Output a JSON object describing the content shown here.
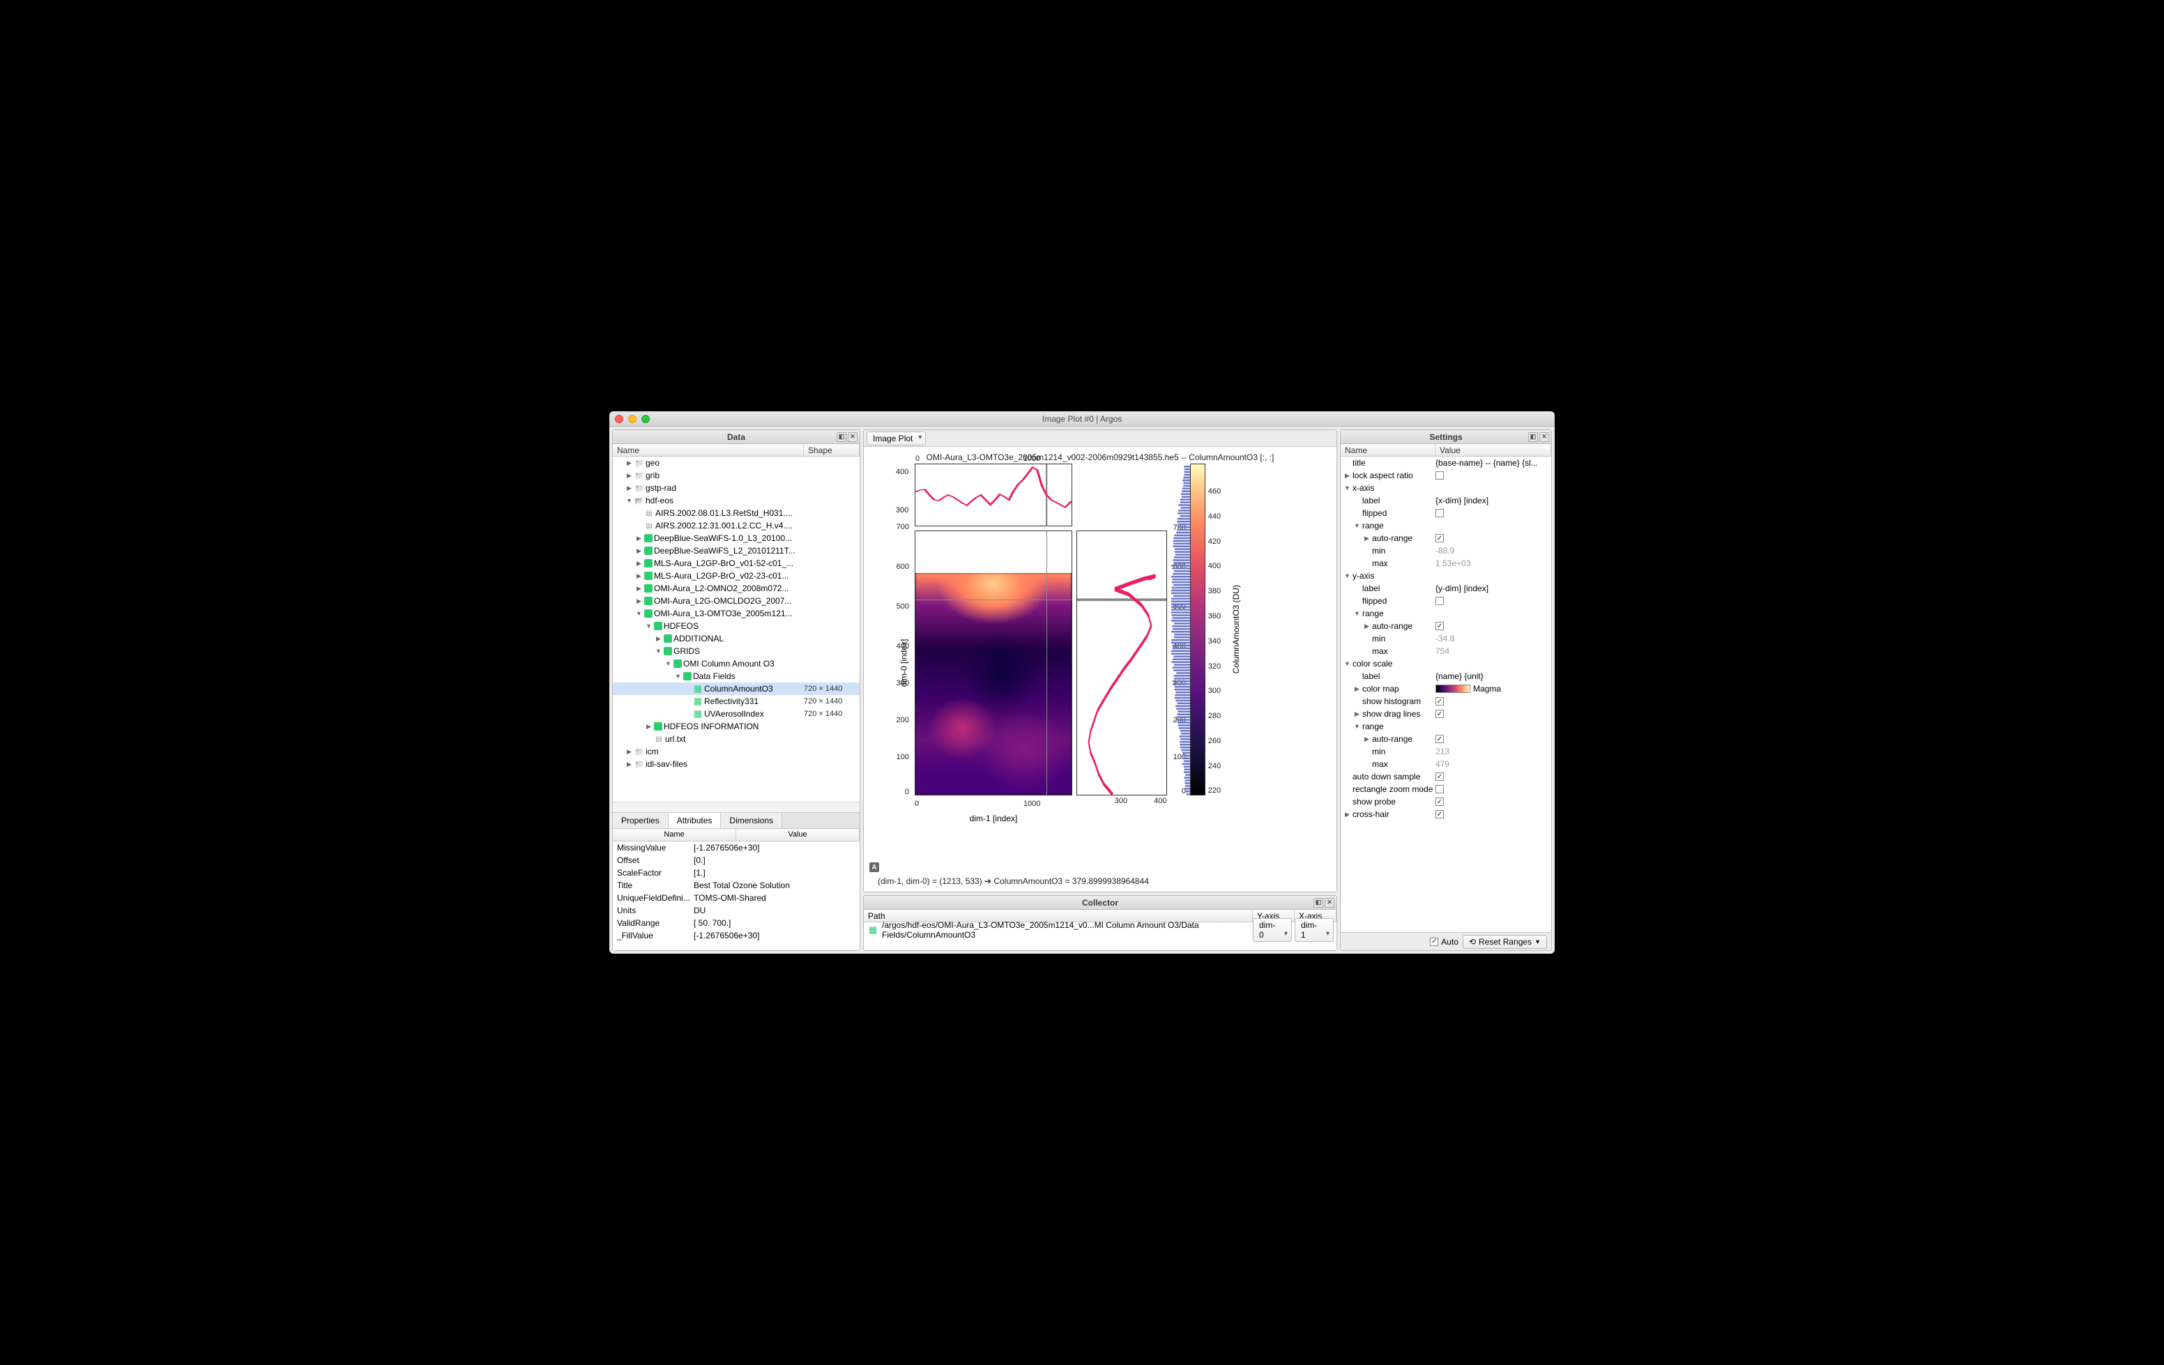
{
  "window": {
    "title": "Image Plot #0 | Argos"
  },
  "data_panel": {
    "title": "Data",
    "columns": {
      "name": "Name",
      "shape": "Shape"
    },
    "tree": [
      {
        "depth": 1,
        "twist": "closed",
        "icon": "folder",
        "label": "geo"
      },
      {
        "depth": 1,
        "twist": "closed",
        "icon": "folder",
        "label": "grib"
      },
      {
        "depth": 1,
        "twist": "closed",
        "icon": "folder",
        "label": "gstp-rad"
      },
      {
        "depth": 1,
        "twist": "open",
        "icon": "ofolder",
        "label": "hdf-eos"
      },
      {
        "depth": 2,
        "twist": "none",
        "icon": "file",
        "label": "AIRS.2002.08.01.L3.RetStd_H031...."
      },
      {
        "depth": 2,
        "twist": "none",
        "icon": "file",
        "label": "AIRS.2002.12.31.001.L2.CC_H.v4...."
      },
      {
        "depth": 2,
        "twist": "closed",
        "icon": "green",
        "label": "DeepBlue-SeaWiFS-1.0_L3_20100..."
      },
      {
        "depth": 2,
        "twist": "closed",
        "icon": "green",
        "label": "DeepBlue-SeaWiFS_L2_20101211T..."
      },
      {
        "depth": 2,
        "twist": "closed",
        "icon": "green",
        "label": "MLS-Aura_L2GP-BrO_v01-52-c01_..."
      },
      {
        "depth": 2,
        "twist": "closed",
        "icon": "green",
        "label": "MLS-Aura_L2GP-BrO_v02-23-c01..."
      },
      {
        "depth": 2,
        "twist": "closed",
        "icon": "green",
        "label": "OMI-Aura_L2-OMNO2_2008m072..."
      },
      {
        "depth": 2,
        "twist": "closed",
        "icon": "green",
        "label": "OMI-Aura_L2G-OMCLDO2G_2007..."
      },
      {
        "depth": 2,
        "twist": "open",
        "icon": "green",
        "label": "OMI-Aura_L3-OMTO3e_2005m121..."
      },
      {
        "depth": 3,
        "twist": "open",
        "icon": "green",
        "label": "HDFEOS"
      },
      {
        "depth": 4,
        "twist": "closed",
        "icon": "green",
        "label": "ADDITIONAL"
      },
      {
        "depth": 4,
        "twist": "open",
        "icon": "green",
        "label": "GRIDS"
      },
      {
        "depth": 5,
        "twist": "open",
        "icon": "green",
        "label": "OMI Column Amount O3"
      },
      {
        "depth": 6,
        "twist": "open",
        "icon": "green",
        "label": "Data Fields"
      },
      {
        "depth": 7,
        "twist": "none",
        "icon": "greeng",
        "label": "ColumnAmountO3",
        "shape": "720 × 1440",
        "selected": true
      },
      {
        "depth": 7,
        "twist": "none",
        "icon": "greeng",
        "label": "Reflectivity331",
        "shape": "720 × 1440"
      },
      {
        "depth": 7,
        "twist": "none",
        "icon": "greeng",
        "label": "UVAerosolIndex",
        "shape": "720 × 1440"
      },
      {
        "depth": 3,
        "twist": "closed",
        "icon": "green",
        "label": "HDFEOS INFORMATION"
      },
      {
        "depth": 3,
        "twist": "none",
        "icon": "file",
        "label": "url.txt"
      },
      {
        "depth": 1,
        "twist": "closed",
        "icon": "folder",
        "label": "icm"
      },
      {
        "depth": 1,
        "twist": "closed",
        "icon": "folder",
        "label": "idl-sav-files"
      }
    ],
    "tabs": {
      "t0": "Properties",
      "t1": "Attributes",
      "t2": "Dimensions",
      "active": 1
    },
    "attr_head": {
      "name": "Name",
      "value": "Value"
    },
    "attributes": [
      {
        "name": "MissingValue",
        "value": "[-1.2676506e+30]"
      },
      {
        "name": "Offset",
        "value": "[0.]"
      },
      {
        "name": "ScaleFactor",
        "value": "[1.]"
      },
      {
        "name": "Title",
        "value": "Best Total Ozone Solution"
      },
      {
        "name": "UniqueFieldDefini...",
        "value": "TOMS-OMI-Shared"
      },
      {
        "name": "Units",
        "value": "DU"
      },
      {
        "name": "ValidRange",
        "value": "[ 50. 700.]"
      },
      {
        "name": "_FillValue",
        "value": "[-1.2676506e+30]"
      }
    ]
  },
  "center_panel": {
    "toolbar": {
      "inspector": "Image Plot"
    },
    "plot_title": "OMI-Aura_L3-OMTO3e_2005m1214_v002-2006m0929t143855.he5 -- ColumnAmountO3 [:, :]",
    "ylabel": "dim-0  [index]",
    "xlabel": "dim-1  [index]",
    "cbar_label": "ColumnAmountO3 (DU)",
    "probe": "(dim-1, dim-0) = (1213, 533) ➔ ColumnAmountO3 = 379.8999938964844",
    "corner": "A"
  },
  "chart_data": {
    "type": "heatmap",
    "title": "OMI-Aura_L3-OMTO3e_2005m1214_v002-2006m0929t143855.he5 -- ColumnAmountO3 [:, :]",
    "xlabel": "dim-1  [index]",
    "ylabel": "dim-0  [index]",
    "x_range": [
      0,
      1440
    ],
    "y_range": [
      0,
      720
    ],
    "x_ticks": [
      0,
      1000
    ],
    "y_ticks": [
      0,
      100,
      200,
      300,
      400,
      500,
      600,
      700
    ],
    "colorbar": {
      "label": "ColumnAmountO3 (DU)",
      "colormap": "Magma",
      "range": [
        213,
        479
      ],
      "ticks": [
        220,
        240,
        260,
        280,
        300,
        320,
        340,
        360,
        380,
        400,
        420,
        440,
        460
      ]
    },
    "top_profile": {
      "type": "line",
      "description": "horizontal cross-section at dim-0 = 533",
      "x_range": [
        0,
        1440
      ],
      "x_ticks": [
        0,
        1000
      ],
      "y_range": [
        260,
        420
      ],
      "y_ticks": [
        300,
        400
      ],
      "approx_values": [
        335,
        340,
        342,
        330,
        320,
        318,
        324,
        330,
        325,
        320,
        314,
        308,
        316,
        324,
        330,
        320,
        310,
        320,
        332,
        326,
        320,
        338,
        352,
        360,
        372,
        386,
        400,
        392,
        360,
        340,
        330,
        320,
        312,
        308,
        302,
        296,
        300,
        310
      ]
    },
    "side_profile": {
      "type": "line",
      "description": "vertical cross-section at dim-1 = 1213",
      "y_range": [
        0,
        720
      ],
      "y_ticks": [
        0,
        100,
        200,
        300,
        400,
        500,
        600,
        700
      ],
      "x_range": [
        200,
        420
      ],
      "x_ticks": [
        300,
        400
      ],
      "approx_values": [
        290,
        270,
        258,
        250,
        238,
        232,
        236,
        244,
        252,
        266,
        282,
        298,
        316,
        334,
        352,
        368,
        380,
        372,
        356,
        332,
        300,
        330,
        365,
        395,
        380,
        350,
        320,
        300,
        290,
        285
      ]
    },
    "crosshair": {
      "dim0": 533,
      "dim1": 1213,
      "value": 379.8999938964844,
      "units": "DU"
    }
  },
  "settings_panel": {
    "title": "Settings",
    "columns": {
      "name": "Name",
      "value": "Value"
    },
    "rows": [
      {
        "d": 0,
        "tw": "",
        "name": "title",
        "vtype": "text",
        "value": "{base-name} -- {name} {sl..."
      },
      {
        "d": 0,
        "tw": "closed",
        "name": "lock aspect ratio",
        "vtype": "chk",
        "value": false
      },
      {
        "d": 0,
        "tw": "open",
        "name": "x-axis",
        "vtype": "",
        "value": ""
      },
      {
        "d": 1,
        "tw": "",
        "name": "label",
        "vtype": "text",
        "value": "{x-dim} [index]"
      },
      {
        "d": 1,
        "tw": "",
        "name": "flipped",
        "vtype": "chk",
        "value": false
      },
      {
        "d": 1,
        "tw": "open",
        "name": "range",
        "vtype": "",
        "value": ""
      },
      {
        "d": 2,
        "tw": "closed",
        "name": "auto-range",
        "vtype": "chk",
        "value": true
      },
      {
        "d": 2,
        "tw": "",
        "name": "min",
        "vtype": "disabled",
        "value": "-88.9"
      },
      {
        "d": 2,
        "tw": "",
        "name": "max",
        "vtype": "disabled",
        "value": "1.53e+03"
      },
      {
        "d": 0,
        "tw": "open",
        "name": "y-axis",
        "vtype": "",
        "value": ""
      },
      {
        "d": 1,
        "tw": "",
        "name": "label",
        "vtype": "text",
        "value": "{y-dim} [index]"
      },
      {
        "d": 1,
        "tw": "",
        "name": "flipped",
        "vtype": "chk",
        "value": false
      },
      {
        "d": 1,
        "tw": "open",
        "name": "range",
        "vtype": "",
        "value": ""
      },
      {
        "d": 2,
        "tw": "closed",
        "name": "auto-range",
        "vtype": "chk",
        "value": true
      },
      {
        "d": 2,
        "tw": "",
        "name": "min",
        "vtype": "disabled",
        "value": "-34.8"
      },
      {
        "d": 2,
        "tw": "",
        "name": "max",
        "vtype": "disabled",
        "value": "754"
      },
      {
        "d": 0,
        "tw": "open",
        "name": "color scale",
        "vtype": "",
        "value": ""
      },
      {
        "d": 1,
        "tw": "",
        "name": "label",
        "vtype": "text",
        "value": "{name} {unit}"
      },
      {
        "d": 1,
        "tw": "closed",
        "name": "color map",
        "vtype": "cmap",
        "value": "Magma"
      },
      {
        "d": 1,
        "tw": "",
        "name": "show histogram",
        "vtype": "chk",
        "value": true
      },
      {
        "d": 1,
        "tw": "closed",
        "name": "show drag lines",
        "vtype": "chk",
        "value": true
      },
      {
        "d": 1,
        "tw": "open",
        "name": "range",
        "vtype": "",
        "value": ""
      },
      {
        "d": 2,
        "tw": "closed",
        "name": "auto-range",
        "vtype": "chk",
        "value": true
      },
      {
        "d": 2,
        "tw": "",
        "name": "min",
        "vtype": "disabled",
        "value": "213"
      },
      {
        "d": 2,
        "tw": "",
        "name": "max",
        "vtype": "disabled",
        "value": "479"
      },
      {
        "d": 0,
        "tw": "",
        "name": "auto down sample",
        "vtype": "chk",
        "value": true
      },
      {
        "d": 0,
        "tw": "",
        "name": "rectangle zoom mode",
        "vtype": "chk",
        "value": false
      },
      {
        "d": 0,
        "tw": "",
        "name": "show probe",
        "vtype": "chk",
        "value": true
      },
      {
        "d": 0,
        "tw": "closed",
        "name": "cross-hair",
        "vtype": "chk",
        "value": true
      }
    ],
    "footer": {
      "auto_label": "Auto",
      "reset_label": "Reset Ranges"
    }
  },
  "collector": {
    "title": "Collector",
    "columns": {
      "path": "Path",
      "y": "Y-axis",
      "x": "X-axis"
    },
    "row": {
      "path": "/argos/hdf-eos/OMI-Aura_L3-OMTO3e_2005m1214_v0...MI Column Amount O3/Data Fields/ColumnAmountO3",
      "y": "dim-0",
      "x": "dim-1"
    }
  }
}
